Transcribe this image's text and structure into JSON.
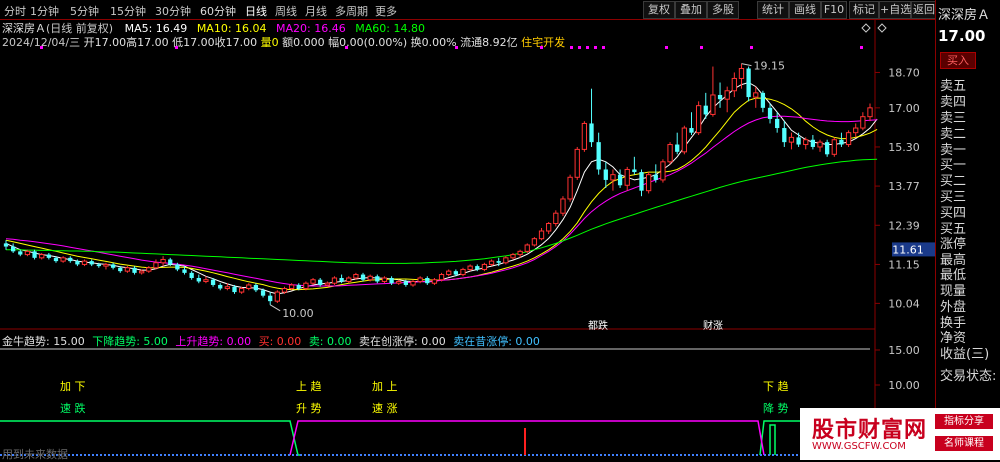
{
  "toolbar": {
    "timeframes": [
      "分时",
      "1分钟",
      "5分钟",
      "15分钟",
      "30分钟",
      "60分钟",
      "日线",
      "周线",
      "月线",
      "多周期",
      "更多"
    ],
    "active_timeframe": "日线",
    "buttons": [
      "复权",
      "叠加",
      "多股",
      "统计",
      "画线",
      "F10",
      "标记",
      "+自选",
      "返回"
    ]
  },
  "info": {
    "stock_name": "深深房Ａ",
    "period_label": "(日线 前复权)",
    "ma5_label": "MA5: 16.49",
    "ma10_label": "MA10: 16.04",
    "ma20_label": "MA20: 16.46",
    "ma60_label": "MA60: 14.80",
    "date_line": "2024/12/04/三",
    "open": "开17.00",
    "high": "高17.00",
    "low": "低17.00",
    "close": "收17.00",
    "volume": "量0",
    "amount": "额0.000",
    "change": "幅0.00(0.00%)",
    "turnover": "换0.00%",
    "float_cap": "流通8.92亿",
    "sector": "住宅开发",
    "colors": {
      "ma5": "#ffffff",
      "ma10": "#ffff00",
      "ma20": "#ff00ff",
      "ma60": "#00ff00"
    }
  },
  "price_axis": {
    "ticks": [
      "18.70",
      "17.00",
      "15.30",
      "13.77",
      "12.39",
      "11.15",
      "10.04"
    ],
    "current_tag": "11.61",
    "ind_ticks": [
      "15.00",
      "10.00"
    ]
  },
  "chart_data": {
    "type": "candlestick",
    "ylim": [
      9.6,
      19.6
    ],
    "high_annotation": "19.15",
    "low_annotation": "10.00",
    "event_labels": [
      "都跌",
      "财涨"
    ],
    "candles": [
      [
        11.8,
        11.9,
        11.6,
        11.7
      ],
      [
        11.7,
        11.8,
        11.5,
        11.55
      ],
      [
        11.55,
        11.6,
        11.4,
        11.45
      ],
      [
        11.45,
        11.6,
        11.4,
        11.55
      ],
      [
        11.55,
        11.6,
        11.3,
        11.35
      ],
      [
        11.35,
        11.5,
        11.3,
        11.45
      ],
      [
        11.45,
        11.5,
        11.3,
        11.35
      ],
      [
        11.35,
        11.4,
        11.2,
        11.25
      ],
      [
        11.25,
        11.4,
        11.2,
        11.35
      ],
      [
        11.35,
        11.4,
        11.2,
        11.25
      ],
      [
        11.25,
        11.3,
        11.1,
        11.15
      ],
      [
        11.15,
        11.3,
        11.1,
        11.25
      ],
      [
        11.25,
        11.3,
        11.1,
        11.15
      ],
      [
        11.15,
        11.2,
        11.05,
        11.1
      ],
      [
        11.1,
        11.2,
        11.0,
        11.15
      ],
      [
        11.15,
        11.2,
        11.0,
        11.05
      ],
      [
        11.05,
        11.1,
        10.9,
        10.95
      ],
      [
        10.95,
        11.1,
        10.9,
        11.05
      ],
      [
        11.05,
        11.1,
        10.85,
        10.9
      ],
      [
        10.9,
        11.0,
        10.85,
        10.95
      ],
      [
        10.95,
        11.1,
        10.9,
        11.05
      ],
      [
        11.05,
        11.3,
        11.0,
        11.2
      ],
      [
        11.2,
        11.4,
        11.1,
        11.3
      ],
      [
        11.3,
        11.35,
        11.1,
        11.15
      ],
      [
        11.15,
        11.2,
        10.95,
        11.0
      ],
      [
        11.0,
        11.1,
        10.85,
        10.9
      ],
      [
        10.9,
        10.95,
        10.7,
        10.75
      ],
      [
        10.75,
        10.85,
        10.6,
        10.65
      ],
      [
        10.65,
        10.8,
        10.6,
        10.7
      ],
      [
        10.7,
        10.75,
        10.5,
        10.55
      ],
      [
        10.55,
        10.6,
        10.4,
        10.45
      ],
      [
        10.45,
        10.6,
        10.4,
        10.5
      ],
      [
        10.5,
        10.55,
        10.3,
        10.35
      ],
      [
        10.35,
        10.5,
        10.3,
        10.45
      ],
      [
        10.45,
        10.6,
        10.4,
        10.55
      ],
      [
        10.55,
        10.6,
        10.35,
        10.4
      ],
      [
        10.4,
        10.45,
        10.2,
        10.25
      ],
      [
        10.25,
        10.35,
        10.0,
        10.1
      ],
      [
        10.1,
        10.4,
        10.05,
        10.35
      ],
      [
        10.35,
        10.5,
        10.3,
        10.45
      ],
      [
        10.45,
        10.6,
        10.4,
        10.55
      ],
      [
        10.55,
        10.6,
        10.4,
        10.45
      ],
      [
        10.45,
        10.65,
        10.4,
        10.6
      ],
      [
        10.6,
        10.75,
        10.55,
        10.7
      ],
      [
        10.7,
        10.75,
        10.5,
        10.55
      ],
      [
        10.55,
        10.65,
        10.5,
        10.6
      ],
      [
        10.6,
        10.8,
        10.55,
        10.75
      ],
      [
        10.75,
        10.85,
        10.6,
        10.65
      ],
      [
        10.65,
        10.8,
        10.6,
        10.75
      ],
      [
        10.75,
        10.9,
        10.7,
        10.85
      ],
      [
        10.85,
        10.9,
        10.65,
        10.7
      ],
      [
        10.7,
        10.85,
        10.65,
        10.8
      ],
      [
        10.8,
        10.85,
        10.6,
        10.65
      ],
      [
        10.65,
        10.8,
        10.6,
        10.75
      ],
      [
        10.75,
        10.8,
        10.55,
        10.6
      ],
      [
        10.6,
        10.7,
        10.55,
        10.65
      ],
      [
        10.65,
        10.7,
        10.5,
        10.55
      ],
      [
        10.55,
        10.7,
        10.5,
        10.65
      ],
      [
        10.65,
        10.8,
        10.6,
        10.75
      ],
      [
        10.75,
        10.8,
        10.55,
        10.6
      ],
      [
        10.6,
        10.75,
        10.55,
        10.7
      ],
      [
        10.7,
        10.9,
        10.65,
        10.85
      ],
      [
        10.85,
        11.0,
        10.8,
        10.95
      ],
      [
        10.95,
        11.0,
        10.8,
        10.85
      ],
      [
        10.85,
        11.05,
        10.8,
        11.0
      ],
      [
        11.0,
        11.15,
        10.95,
        11.1
      ],
      [
        11.1,
        11.15,
        10.95,
        11.0
      ],
      [
        11.0,
        11.2,
        10.95,
        11.15
      ],
      [
        11.15,
        11.3,
        11.1,
        11.25
      ],
      [
        11.25,
        11.35,
        11.1,
        11.2
      ],
      [
        11.2,
        11.4,
        11.15,
        11.35
      ],
      [
        11.35,
        11.5,
        11.3,
        11.45
      ],
      [
        11.45,
        11.6,
        11.35,
        11.55
      ],
      [
        11.55,
        11.8,
        11.5,
        11.75
      ],
      [
        11.75,
        12.0,
        11.7,
        11.95
      ],
      [
        11.95,
        12.3,
        11.9,
        12.2
      ],
      [
        12.2,
        12.5,
        12.1,
        12.45
      ],
      [
        12.45,
        12.9,
        12.35,
        12.8
      ],
      [
        12.8,
        13.4,
        12.7,
        13.3
      ],
      [
        13.3,
        14.2,
        13.2,
        14.1
      ],
      [
        14.1,
        15.3,
        14.0,
        15.2
      ],
      [
        15.2,
        16.4,
        15.1,
        16.3
      ],
      [
        16.3,
        17.9,
        15.3,
        15.5
      ],
      [
        15.5,
        15.9,
        14.2,
        14.4
      ],
      [
        14.4,
        14.7,
        13.7,
        14.0
      ],
      [
        14.0,
        14.4,
        13.6,
        14.2
      ],
      [
        14.2,
        14.4,
        13.7,
        13.8
      ],
      [
        13.8,
        14.5,
        13.6,
        14.4
      ],
      [
        14.4,
        14.9,
        14.2,
        14.3
      ],
      [
        14.3,
        14.4,
        13.4,
        13.6
      ],
      [
        13.6,
        14.3,
        13.5,
        14.2
      ],
      [
        14.2,
        14.6,
        13.9,
        14.0
      ],
      [
        14.0,
        14.8,
        13.9,
        14.7
      ],
      [
        14.7,
        15.5,
        14.6,
        15.4
      ],
      [
        15.4,
        15.9,
        15.0,
        15.1
      ],
      [
        15.1,
        16.2,
        15.0,
        16.1
      ],
      [
        16.1,
        16.8,
        15.8,
        15.9
      ],
      [
        15.9,
        17.3,
        15.8,
        17.1
      ],
      [
        17.1,
        17.7,
        16.5,
        16.7
      ],
      [
        16.7,
        19.0,
        16.6,
        17.6
      ],
      [
        17.6,
        18.2,
        17.0,
        17.4
      ],
      [
        17.4,
        18.0,
        16.8,
        17.8
      ],
      [
        17.8,
        18.7,
        17.5,
        18.4
      ],
      [
        18.4,
        19.15,
        17.9,
        18.9
      ],
      [
        18.9,
        19.0,
        17.3,
        17.5
      ],
      [
        17.5,
        18.0,
        17.0,
        17.7
      ],
      [
        17.7,
        17.8,
        16.8,
        17.0
      ],
      [
        17.0,
        17.2,
        16.3,
        16.5
      ],
      [
        16.5,
        16.8,
        15.9,
        16.1
      ],
      [
        16.1,
        16.4,
        15.3,
        15.5
      ],
      [
        15.5,
        15.9,
        15.2,
        15.7
      ],
      [
        15.7,
        15.9,
        15.3,
        15.4
      ],
      [
        15.4,
        15.7,
        15.2,
        15.6
      ],
      [
        15.6,
        15.8,
        15.2,
        15.3
      ],
      [
        15.3,
        15.6,
        15.1,
        15.5
      ],
      [
        15.5,
        15.6,
        14.9,
        15.0
      ],
      [
        15.0,
        15.7,
        14.9,
        15.6
      ],
      [
        15.6,
        15.9,
        15.3,
        15.4
      ],
      [
        15.4,
        16.0,
        15.3,
        15.9
      ],
      [
        15.9,
        16.3,
        15.7,
        16.1
      ],
      [
        16.1,
        16.8,
        16.0,
        16.6
      ],
      [
        16.6,
        17.2,
        16.4,
        17.0
      ]
    ],
    "series": [
      {
        "name": "MA5",
        "values": [
          11.8,
          11.7,
          11.6,
          11.55,
          11.5,
          11.45,
          11.42,
          11.38,
          11.33,
          11.3,
          11.25,
          11.22,
          11.2,
          11.17,
          11.15,
          11.12,
          11.08,
          11.05,
          11.02,
          10.98,
          10.98,
          11.02,
          11.1,
          11.15,
          11.13,
          11.1,
          11.0,
          10.9,
          10.8,
          10.73,
          10.65,
          10.58,
          10.52,
          10.48,
          10.47,
          10.46,
          10.42,
          10.35,
          10.3,
          10.33,
          10.38,
          10.45,
          10.5,
          10.55,
          10.58,
          10.6,
          10.63,
          10.65,
          10.68,
          10.72,
          10.75,
          10.76,
          10.75,
          10.74,
          10.72,
          10.7,
          10.66,
          10.65,
          10.65,
          10.64,
          10.65,
          10.7,
          10.76,
          10.82,
          10.88,
          10.95,
          11.0,
          11.05,
          11.1,
          11.15,
          11.22,
          11.28,
          11.36,
          11.46,
          11.6,
          11.76,
          11.96,
          12.24,
          12.58,
          13.0,
          13.6,
          14.3,
          14.7,
          14.8,
          14.7,
          14.5,
          14.2,
          14.1,
          14.0,
          14.05,
          14.1,
          14.2,
          14.4,
          14.6,
          14.9,
          15.3,
          15.7,
          16.1,
          16.6,
          17.0,
          17.3,
          17.6,
          17.9,
          18.1,
          18.2,
          18.0,
          17.6,
          17.2,
          16.8,
          16.4,
          16.0,
          15.8,
          15.6,
          15.5,
          15.45,
          15.4,
          15.4,
          15.45,
          15.5,
          15.65,
          15.85,
          16.1,
          16.49
        ]
      },
      {
        "name": "MA10",
        "values": [
          11.9,
          11.85,
          11.8,
          11.75,
          11.7,
          11.65,
          11.6,
          11.55,
          11.5,
          11.45,
          11.4,
          11.36,
          11.32,
          11.28,
          11.24,
          11.2,
          11.16,
          11.13,
          11.1,
          11.07,
          11.05,
          11.05,
          11.06,
          11.07,
          11.07,
          11.06,
          11.03,
          10.99,
          10.95,
          10.9,
          10.85,
          10.79,
          10.74,
          10.69,
          10.64,
          10.6,
          10.56,
          10.5,
          10.46,
          10.43,
          10.42,
          10.42,
          10.43,
          10.44,
          10.46,
          10.48,
          10.52,
          10.56,
          10.6,
          10.63,
          10.66,
          10.69,
          10.7,
          10.71,
          10.72,
          10.72,
          10.72,
          10.71,
          10.7,
          10.7,
          10.69,
          10.69,
          10.7,
          10.72,
          10.75,
          10.78,
          10.82,
          10.87,
          10.92,
          10.98,
          11.04,
          11.1,
          11.17,
          11.25,
          11.35,
          11.47,
          11.6,
          11.76,
          11.95,
          12.18,
          12.47,
          12.85,
          13.2,
          13.5,
          13.75,
          13.95,
          14.05,
          14.15,
          14.2,
          14.25,
          14.3,
          14.3,
          14.3,
          14.33,
          14.4,
          14.55,
          14.75,
          15.0,
          15.3,
          15.65,
          16.0,
          16.4,
          16.8,
          17.1,
          17.35,
          17.45,
          17.45,
          17.4,
          17.3,
          17.15,
          16.95,
          16.7,
          16.4,
          16.15,
          15.95,
          15.8,
          15.7,
          15.65,
          15.65,
          15.7,
          15.78,
          15.88,
          16.04
        ]
      },
      {
        "name": "MA20",
        "values": [
          11.95,
          11.93,
          11.9,
          11.88,
          11.85,
          11.82,
          11.79,
          11.76,
          11.72,
          11.68,
          11.64,
          11.6,
          11.56,
          11.52,
          11.48,
          11.44,
          11.4,
          11.36,
          11.32,
          11.28,
          11.25,
          11.22,
          11.2,
          11.18,
          11.16,
          11.13,
          11.1,
          11.06,
          11.02,
          10.98,
          10.94,
          10.9,
          10.86,
          10.82,
          10.78,
          10.74,
          10.7,
          10.66,
          10.62,
          10.59,
          10.56,
          10.54,
          10.53,
          10.52,
          10.52,
          10.52,
          10.52,
          10.53,
          10.54,
          10.55,
          10.56,
          10.57,
          10.58,
          10.59,
          10.6,
          10.61,
          10.62,
          10.63,
          10.64,
          10.65,
          10.66,
          10.68,
          10.7,
          10.72,
          10.75,
          10.78,
          10.81,
          10.85,
          10.89,
          10.94,
          10.99,
          11.05,
          11.12,
          11.2,
          11.3,
          11.42,
          11.55,
          11.7,
          11.88,
          12.1,
          12.35,
          12.62,
          12.85,
          13.05,
          13.22,
          13.37,
          13.5,
          13.6,
          13.7,
          13.8,
          13.9,
          14.0,
          14.1,
          14.2,
          14.33,
          14.48,
          14.65,
          14.85,
          15.05,
          15.28,
          15.5,
          15.73,
          15.95,
          16.15,
          16.32,
          16.45,
          16.55,
          16.6,
          16.62,
          16.62,
          16.6,
          16.57,
          16.52,
          16.48,
          16.44,
          16.41,
          16.39,
          16.38,
          16.38,
          16.4,
          16.42,
          16.44,
          16.46
        ]
      },
      {
        "name": "MA60",
        "values": [
          11.6,
          11.6,
          11.6,
          11.59,
          11.59,
          11.58,
          11.58,
          11.57,
          11.57,
          11.56,
          11.56,
          11.55,
          11.55,
          11.54,
          11.53,
          11.53,
          11.52,
          11.51,
          11.5,
          11.49,
          11.48,
          11.47,
          11.46,
          11.45,
          11.44,
          11.43,
          11.42,
          11.41,
          11.4,
          11.39,
          11.38,
          11.37,
          11.36,
          11.35,
          11.34,
          11.33,
          11.32,
          11.31,
          11.3,
          11.29,
          11.28,
          11.27,
          11.26,
          11.25,
          11.24,
          11.23,
          11.22,
          11.21,
          11.2,
          11.2,
          11.19,
          11.19,
          11.18,
          11.18,
          11.18,
          11.18,
          11.18,
          11.19,
          11.19,
          11.2,
          11.21,
          11.22,
          11.23,
          11.24,
          11.26,
          11.28,
          11.3,
          11.32,
          11.35,
          11.38,
          11.41,
          11.45,
          11.49,
          11.54,
          11.6,
          11.66,
          11.73,
          11.8,
          11.88,
          11.97,
          12.06,
          12.16,
          12.26,
          12.35,
          12.44,
          12.52,
          12.6,
          12.68,
          12.76,
          12.84,
          12.92,
          13.0,
          13.08,
          13.16,
          13.24,
          13.32,
          13.4,
          13.48,
          13.56,
          13.64,
          13.72,
          13.8,
          13.87,
          13.94,
          14.0,
          14.06,
          14.12,
          14.18,
          14.24,
          14.3,
          14.36,
          14.42,
          14.48,
          14.53,
          14.58,
          14.62,
          14.66,
          14.7,
          14.73,
          14.76,
          14.78,
          14.79,
          14.8
        ]
      }
    ]
  },
  "indicator": {
    "title": "金牛趋势",
    "value": ": 15.00",
    "down_trend": "下降趋势: 5.00",
    "up_trend": "上升趋势: 0.00",
    "buy": "买: 0.00",
    "sell": "卖: 0.00",
    "sell_new_high": "卖在创涨停: 0.00",
    "sell_prev_high": "卖在昔涨停: 0.00",
    "annotations": {
      "a1_line1": "加 下",
      "a1_line2": "速 跌",
      "a2_line1": "上 趋",
      "a2_line2": "升 势",
      "a3_line1": "加 上",
      "a3_line2": "速 涨",
      "a4_line1": "下 趋",
      "a4_line2": "降 势"
    }
  },
  "sidebar": {
    "title": "深深房Ａ",
    "price": "17.00",
    "buy_button": "买入",
    "rows": [
      "卖五",
      "卖四",
      "卖三",
      "卖二",
      "卖一",
      "买一",
      "买二",
      "买三",
      "买四",
      "买五",
      "涨停",
      "最高",
      "最低",
      "现量",
      "外盘",
      "换手",
      "净资",
      "收益(三)",
      "交易状态:"
    ]
  },
  "brand": {
    "main": "股市财富网",
    "url": "WWW.GSCFW.COM",
    "tag1": "指标分享",
    "tag2": "名师课程"
  },
  "footer": {
    "text": "用到未来数据"
  }
}
